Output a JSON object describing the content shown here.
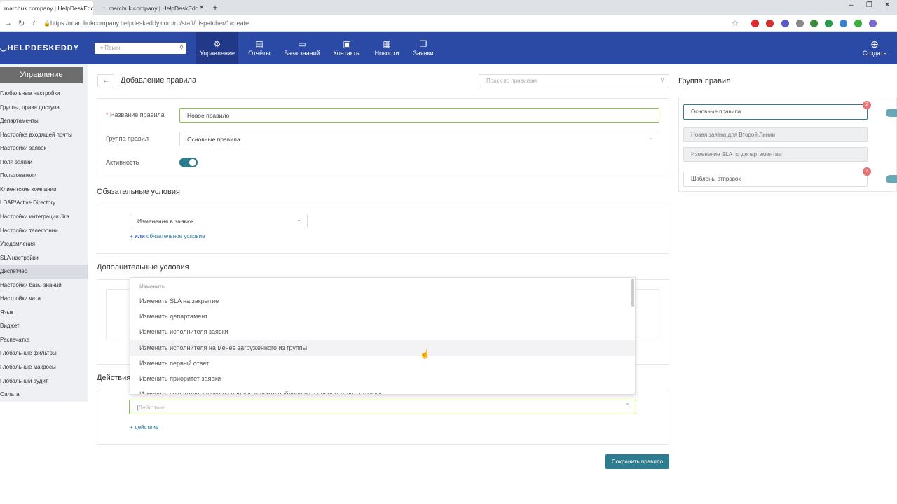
{
  "browser": {
    "tabs": [
      {
        "title": "marchuk company | HelpDeskEdd",
        "active": true
      },
      {
        "title": "marchuk company | HelpDeskEdd",
        "active": false
      }
    ],
    "url": "https://marchukcompany.helpdeskeddy.com/ru/staff/dispatcher/1/create"
  },
  "topnav": {
    "logo": "HELPDESKEDDY",
    "search_placeholder": "Поиск",
    "items": [
      {
        "label": "Управление",
        "icon": "gear-icon"
      },
      {
        "label": "Отчёты",
        "icon": "report-icon"
      },
      {
        "label": "База знаний",
        "icon": "book-icon"
      },
      {
        "label": "Контакты",
        "icon": "contacts-icon"
      },
      {
        "label": "Новости",
        "icon": "news-icon"
      },
      {
        "label": "Заявки",
        "icon": "tickets-icon"
      }
    ],
    "create_label": "Создать"
  },
  "sidebar": {
    "header": "Управление",
    "items": [
      "Глобальные настройки",
      "Группы, права доступа",
      "Департаменты",
      "Настройка входящей почты",
      "Настройки заявок",
      "Поля заявки",
      "Пользователи",
      "Клиентские компании",
      "LDAP/Active Directory",
      "Настройки интеграции Jira",
      "Настройки телефонии",
      "Уведомления",
      "SLA настройки",
      "Диспетчер",
      "Настройки базы знаний",
      "Настройки чата",
      "Язык",
      "Виджет",
      "Распечатка",
      "Глобальные фильтры",
      "Глобальные макросы",
      "Глобальный аудит",
      "Оплата"
    ],
    "active_index": 13
  },
  "main": {
    "back": "←",
    "title": "Добавление правила",
    "rule_search_placeholder": "Поиск по правилам",
    "form": {
      "name_label": "Название правила",
      "name_value": "Новое правило",
      "group_label": "Группа правил",
      "group_value": "Основные правила",
      "active_label": "Активность",
      "active": true
    },
    "required_conditions": {
      "title": "Обязательные условия",
      "select_value": "Изменения в заявке",
      "add_link_prefix": "+ ",
      "add_link_bold": "или",
      "add_link_text": " обязательное условие"
    },
    "extra_conditions": {
      "title": "Дополнительные условия"
    },
    "actions": {
      "title": "Действия",
      "placeholder": "Действие",
      "add_link": "+ действие"
    },
    "dropdown": {
      "group": "Изменить",
      "items": [
        "Изменить SLA на закрытие",
        "Изменить департамент",
        "Изменить исполнителя заявки",
        "Изменить исполнителя на менее загруженного из группы",
        "Изменить первый ответ",
        "Изменить приоритет заявки",
        "Изменить создателя заявки на первую e-почту найденную в первом ответе заявки"
      ],
      "hover_index": 3
    },
    "save_button": "Сохранить правило"
  },
  "rule_groups": {
    "title": "Группа правил",
    "items": [
      {
        "label": "Основные правила",
        "badge": "2",
        "active": true
      },
      {
        "label": "Новая заявка для Второй Линии",
        "sub": true
      },
      {
        "label": "Изменение SLA по департаментам",
        "sub": true
      },
      {
        "label": "Шаблоны отправок",
        "badge": "2"
      }
    ]
  }
}
